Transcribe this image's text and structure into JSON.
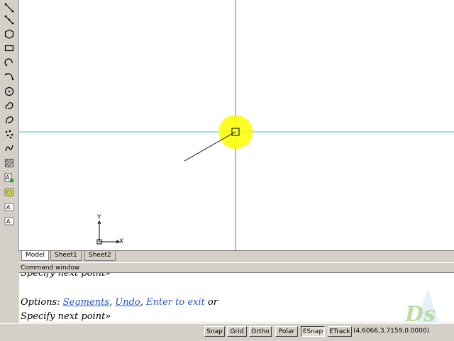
{
  "toolbar": {
    "tools": [
      "line-icon",
      "polyline-icon",
      "polygon-icon",
      "rectangle-icon",
      "arc-icon",
      "spline-icon",
      "circle-icon",
      "revision-cloud-icon",
      "ellipse-icon",
      "points-icon",
      "curve-icon",
      "hatch-icon",
      "insert-block-icon",
      "make-block-icon",
      "text-icon",
      "mtext-icon"
    ]
  },
  "tabs": {
    "model": "Model",
    "sheet1": "Sheet1",
    "sheet2": "Sheet2"
  },
  "command": {
    "header": "Command window",
    "history": "Specify next point»",
    "options_label": "Options:",
    "opt_segments": "Segments",
    "sep1": ",",
    "opt_undo": "Undo",
    "sep2": ",",
    "opt_enter": "Enter to exit",
    "or": "or",
    "prompt": "Specify next point»"
  },
  "ucs": {
    "x_label": "X",
    "y_label": "Y"
  },
  "status": {
    "snap": "Snap",
    "grid": "Grid",
    "ortho": "Ortho",
    "polar": "Polar",
    "esnap": "ESnap",
    "etrack": "ETrack",
    "coords": "(4.6066,3.7159,0.0000)"
  },
  "colors": {
    "crosshair_vertical": "#cc33cc",
    "crosshair_horizontal": "#33cccc",
    "cursor_highlight": "#ffff00",
    "link": "#2255cc"
  }
}
